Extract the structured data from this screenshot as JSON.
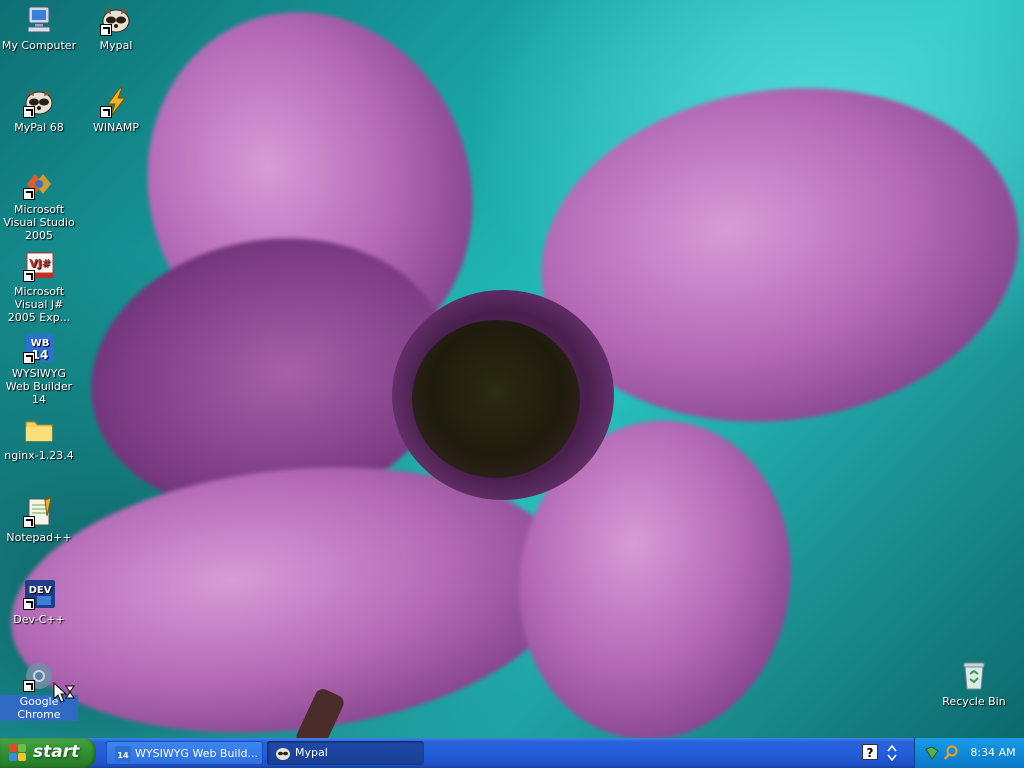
{
  "desktop": {
    "icons": [
      {
        "label": "My Computer",
        "icon": "computer-icon"
      },
      {
        "label": "Mypal",
        "icon": "raccoon-icon"
      },
      {
        "label": "MyPal 68",
        "icon": "raccoon-icon"
      },
      {
        "label": "WINAMP",
        "icon": "lightning-icon"
      },
      {
        "label": "Microsoft Visual Studio 2005",
        "icon": "visual-studio-icon"
      },
      {
        "label": "Microsoft Visual J# 2005 Exp...",
        "icon": "vjsharp-icon"
      },
      {
        "label": "WYSIWYG Web Builder 14",
        "icon": "wb14-icon"
      },
      {
        "label": "nginx-1.23.4",
        "icon": "folder-icon"
      },
      {
        "label": "Notepad++",
        "icon": "notepadpp-icon"
      },
      {
        "label": "Dev-C++",
        "icon": "devcpp-icon"
      },
      {
        "label": "Google Chrome",
        "icon": "chrome-icon"
      },
      {
        "label": "Recycle Bin",
        "icon": "recycle-bin-icon"
      }
    ]
  },
  "taskbar": {
    "start_label": "start",
    "tasks": [
      {
        "label": "WYSIWYG Web Build...",
        "icon": "wb14-icon"
      },
      {
        "label": "Mypal",
        "icon": "raccoon-icon"
      }
    ],
    "help_glyph": "?",
    "clock": "8:34 AM"
  },
  "colors": {
    "taskbar_blue": "#245edc",
    "start_green": "#3c9a3c",
    "tray_blue": "#0e8ad9",
    "selection_blue": "#316ac5"
  }
}
